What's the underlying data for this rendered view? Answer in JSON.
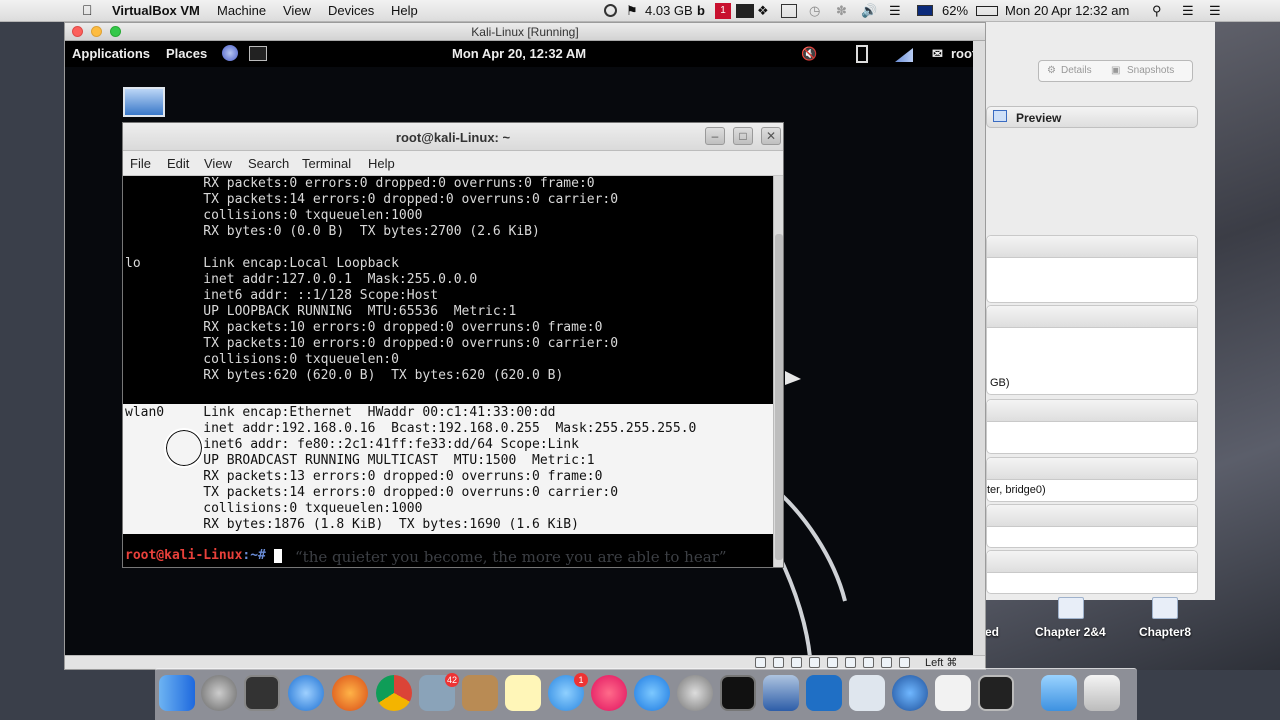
{
  "menubar": {
    "app": "VirtualBox VM",
    "menus": [
      "Machine",
      "View",
      "Devices",
      "Help"
    ],
    "memory": "4.03 GB",
    "badge_count": "1",
    "battery": "62%",
    "datetime": "Mon 20 Apr  12:32 am"
  },
  "vm_window": {
    "title": "Kali-Linux [Running]",
    "status_host_key": "Left ⌘"
  },
  "guest_panel": {
    "applications": "Applications",
    "places": "Places",
    "clock": "Mon Apr 20, 12:32 AM",
    "user": "root"
  },
  "terminal": {
    "title": "root@kali-Linux: ~",
    "menu": [
      "File",
      "Edit",
      "View",
      "Search",
      "Terminal",
      "Help"
    ],
    "lines": [
      "          RX packets:0 errors:0 dropped:0 overruns:0 frame:0",
      "          TX packets:14 errors:0 dropped:0 overruns:0 carrier:0",
      "          collisions:0 txqueuelen:1000",
      "          RX bytes:0 (0.0 B)  TX bytes:2700 (2.6 KiB)",
      "",
      "lo        Link encap:Local Loopback",
      "          inet addr:127.0.0.1  Mask:255.0.0.0",
      "          inet6 addr: ::1/128 Scope:Host",
      "          UP LOOPBACK RUNNING  MTU:65536  Metric:1",
      "          RX packets:10 errors:0 dropped:0 overruns:0 frame:0",
      "          TX packets:10 errors:0 dropped:0 overruns:0 carrier:0",
      "          collisions:0 txqueuelen:0",
      "          RX bytes:620 (620.0 B)  TX bytes:620 (620.0 B)",
      "",
      "wlan0     Link encap:Ethernet  HWaddr 00:c1:41:33:00:dd",
      "          inet addr:192.168.0.16  Bcast:192.168.0.255  Mask:255.255.255.0",
      "          inet6 addr: fe80::2c1:41ff:fe33:dd/64 Scope:Link",
      "          UP BROADCAST RUNNING MULTICAST  MTU:1500  Metric:1",
      "          RX packets:13 errors:0 dropped:0 overruns:0 frame:0",
      "          TX packets:14 errors:0 dropped:0 overruns:0 carrier:0",
      "          collisions:0 txqueuelen:1000",
      "          RX bytes:1876 (1.8 KiB)  TX bytes:1690 (1.6 KiB)"
    ],
    "prompt_user": "root@kali-Linux",
    "prompt_path": ":~# ",
    "wallpaper_quote": "“the quieter you become, the more you are able to hear”"
  },
  "vbox_manager": {
    "tab_details": "Details",
    "tab_snapshots": "Snapshots",
    "preview": "Preview",
    "row1": "GB)",
    "row2": "ter, bridge0)"
  },
  "desktop": {
    "file1": "Chapter 2&4",
    "file2": "Chapter8",
    "file0": "ed"
  },
  "dock": {
    "badge_calendar": "42",
    "badge_messages": "1"
  },
  "colors": {
    "prompt_red": "#e8403a",
    "terminal_bg": "#000000",
    "selection_bg": "#f4f4f4"
  }
}
